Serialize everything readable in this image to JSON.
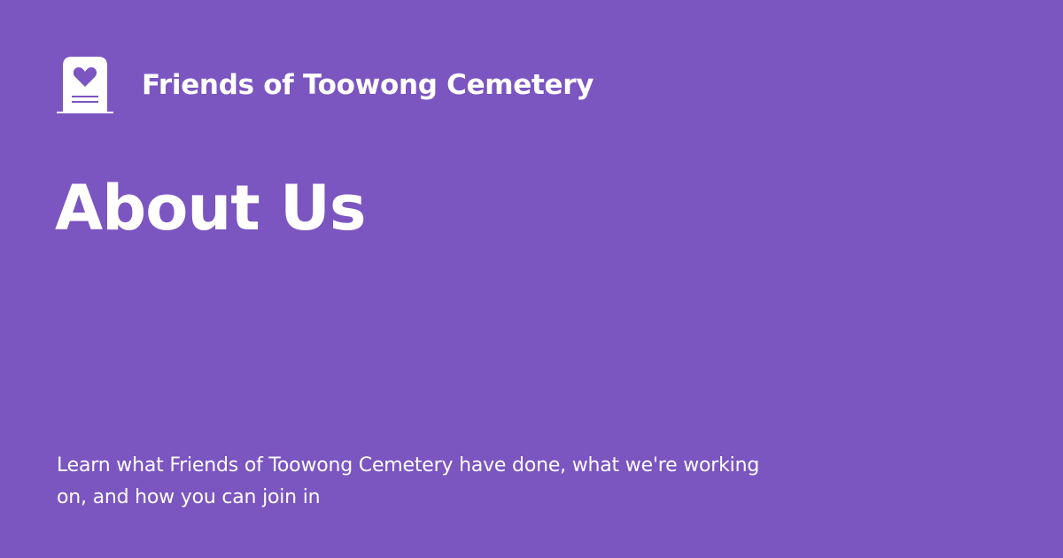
{
  "brand": {
    "name": "Friends of Toowong Cemetery",
    "logo_icon": "headstone-heart-icon"
  },
  "page": {
    "title": "About Us",
    "description": "Learn what Friends of Toowong Cemetery have done, what we're working on, and how you can join in"
  },
  "colors": {
    "background": "#7b55c0",
    "foreground": "#ffffff"
  }
}
